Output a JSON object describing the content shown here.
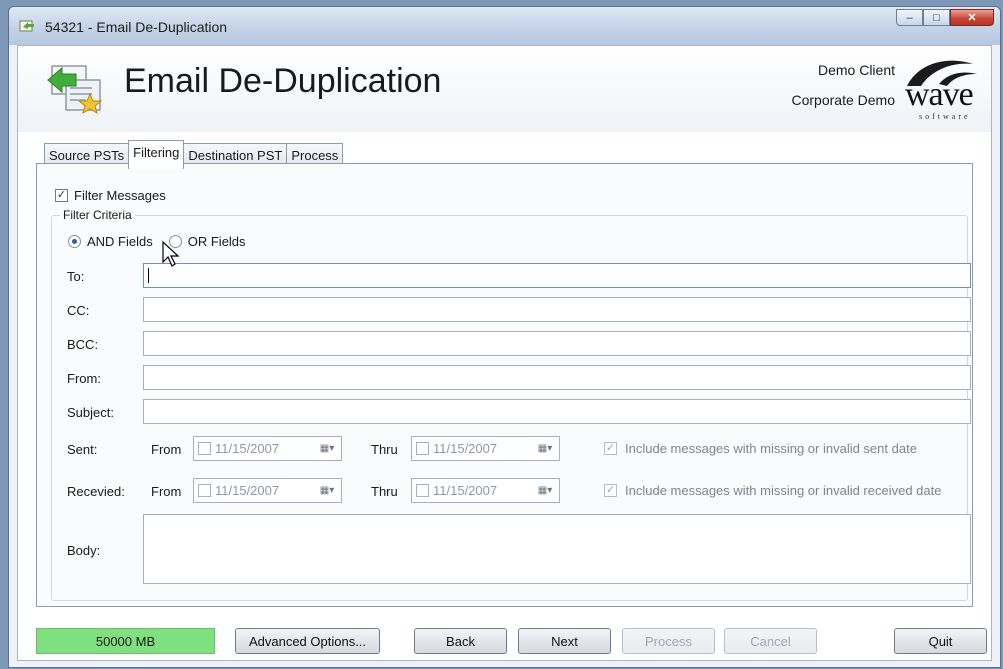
{
  "window": {
    "title": "54321 - Email De-Duplication",
    "controls": [
      "minimize-icon",
      "maximize-icon",
      "close-icon"
    ]
  },
  "header": {
    "title": "Email De-Duplication",
    "client_name": "Demo Client",
    "client_sub": "Corporate Demo",
    "logo_text": "wave",
    "logo_subtext": "software"
  },
  "tabs": [
    {
      "label": "Source PSTs",
      "active": false
    },
    {
      "label": "Filtering",
      "active": true
    },
    {
      "label": "Destination PST",
      "active": false
    },
    {
      "label": "Process",
      "active": false
    }
  ],
  "filtering": {
    "filter_messages": {
      "label": "Filter Messages",
      "checked": true
    },
    "group_title": "Filter Criteria",
    "mode": {
      "and_label": "AND Fields",
      "or_label": "OR Fields",
      "selected": "and"
    },
    "fields": {
      "to": {
        "label": "To:",
        "value": ""
      },
      "cc": {
        "label": "CC:",
        "value": ""
      },
      "bcc": {
        "label": "BCC:",
        "value": ""
      },
      "from": {
        "label": "From:",
        "value": ""
      },
      "subject": {
        "label": "Subject:",
        "value": ""
      }
    },
    "sent": {
      "label": "Sent:",
      "from_label": "From",
      "from_date": "11/15/2007",
      "thru_label": "Thru",
      "thru_date": "11/15/2007",
      "include_label": "Include messages with missing or invalid sent date",
      "include_checked": true
    },
    "received": {
      "label": "Recevied:",
      "from_label": "From",
      "from_date": "11/15/2007",
      "thru_label": "Thru",
      "thru_date": "11/15/2007",
      "include_label": "Include messages with missing or invalid received date",
      "include_checked": true
    },
    "body": {
      "label": "Body:",
      "value": ""
    }
  },
  "footer": {
    "status": "50000 MB",
    "advanced": "Advanced Options...",
    "back": "Back",
    "next": "Next",
    "process": "Process",
    "cancel": "Cancel",
    "quit": "Quit"
  },
  "colors": {
    "status_green": "#80e07f",
    "accent_blue": "#2a62a8"
  }
}
